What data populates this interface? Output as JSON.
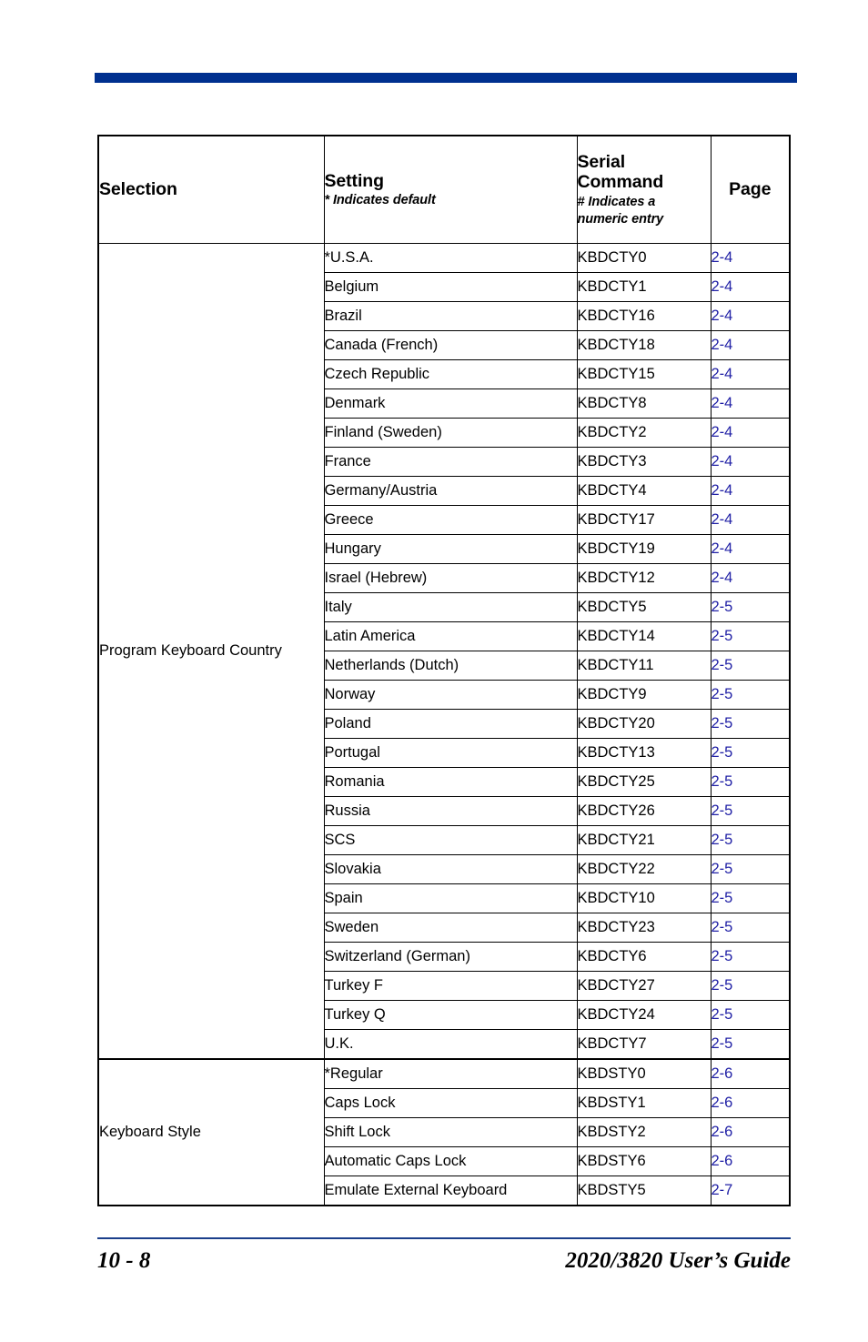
{
  "page": {
    "top_bar_color": "#00308f",
    "link_color": "#1f1fa5",
    "footer_rule_color": "#1b3f8b"
  },
  "table": {
    "headers": {
      "selection": "Selection",
      "setting": "Setting",
      "setting_note": "* Indicates default",
      "serial_command": "Serial Command",
      "serial_command_note_line1": "# Indicates a",
      "serial_command_note_line2": "numeric entry",
      "page": "Page"
    },
    "groups": [
      {
        "selection": "Program Keyboard Country",
        "rows": [
          {
            "setting": "*U.S.A.",
            "command": "KBDCTY0",
            "page": "2-4"
          },
          {
            "setting": "Belgium",
            "command": "KBDCTY1",
            "page": "2-4"
          },
          {
            "setting": "Brazil",
            "command": "KBDCTY16",
            "page": "2-4"
          },
          {
            "setting": "Canada (French)",
            "command": "KBDCTY18",
            "page": "2-4"
          },
          {
            "setting": "Czech Republic",
            "command": "KBDCTY15",
            "page": "2-4"
          },
          {
            "setting": "Denmark",
            "command": "KBDCTY8",
            "page": "2-4"
          },
          {
            "setting": "Finland (Sweden)",
            "command": "KBDCTY2",
            "page": "2-4"
          },
          {
            "setting": "France",
            "command": "KBDCTY3",
            "page": "2-4"
          },
          {
            "setting": "Germany/Austria",
            "command": "KBDCTY4",
            "page": "2-4"
          },
          {
            "setting": "Greece",
            "command": "KBDCTY17",
            "page": "2-4"
          },
          {
            "setting": "Hungary",
            "command": "KBDCTY19",
            "page": "2-4"
          },
          {
            "setting": "Israel (Hebrew)",
            "command": "KBDCTY12",
            "page": "2-4"
          },
          {
            "setting": "Italy",
            "command": "KBDCTY5",
            "page": "2-5"
          },
          {
            "setting": "Latin America",
            "command": "KBDCTY14",
            "page": "2-5"
          },
          {
            "setting": "Netherlands (Dutch)",
            "command": "KBDCTY11",
            "page": "2-5"
          },
          {
            "setting": "Norway",
            "command": "KBDCTY9",
            "page": "2-5"
          },
          {
            "setting": "Poland",
            "command": "KBDCTY20",
            "page": "2-5"
          },
          {
            "setting": "Portugal",
            "command": "KBDCTY13",
            "page": "2-5"
          },
          {
            "setting": "Romania",
            "command": "KBDCTY25",
            "page": "2-5"
          },
          {
            "setting": "Russia",
            "command": "KBDCTY26",
            "page": "2-5"
          },
          {
            "setting": "SCS",
            "command": "KBDCTY21",
            "page": "2-5"
          },
          {
            "setting": "Slovakia",
            "command": "KBDCTY22",
            "page": "2-5"
          },
          {
            "setting": "Spain",
            "command": "KBDCTY10",
            "page": "2-5"
          },
          {
            "setting": "Sweden",
            "command": "KBDCTY23",
            "page": "2-5"
          },
          {
            "setting": "Switzerland (German)",
            "command": "KBDCTY6",
            "page": "2-5"
          },
          {
            "setting": "Turkey F",
            "command": "KBDCTY27",
            "page": "2-5"
          },
          {
            "setting": "Turkey Q",
            "command": "KBDCTY24",
            "page": "2-5"
          },
          {
            "setting": "U.K.",
            "command": "KBDCTY7",
            "page": "2-5"
          }
        ]
      },
      {
        "selection": "Keyboard Style",
        "rows": [
          {
            "setting": "*Regular",
            "command": "KBDSTY0",
            "page": "2-6"
          },
          {
            "setting": "Caps Lock",
            "command": "KBDSTY1",
            "page": "2-6"
          },
          {
            "setting": "Shift Lock",
            "command": "KBDSTY2",
            "page": "2-6"
          },
          {
            "setting": "Automatic Caps Lock",
            "command": "KBDSTY6",
            "page": "2-6"
          },
          {
            "setting": "Emulate External Keyboard",
            "command": "KBDSTY5",
            "page": "2-7"
          }
        ]
      }
    ]
  },
  "footer": {
    "page_number": "10 - 8",
    "guide_title": "2020/3820 User’s Guide"
  }
}
